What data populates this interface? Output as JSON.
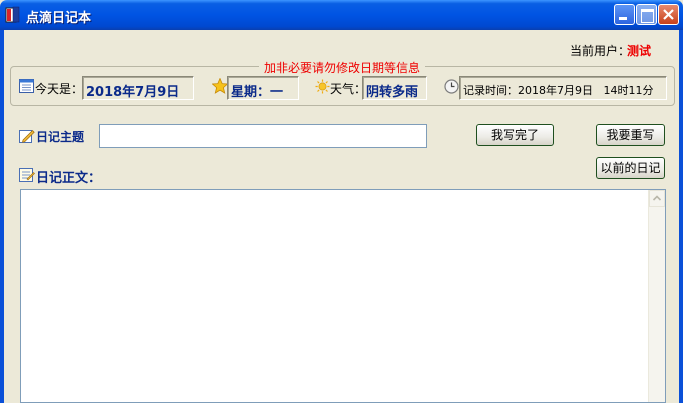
{
  "window": {
    "title": "点滴日记本"
  },
  "user": {
    "label": "当前用户：",
    "name": "测试"
  },
  "info_group": {
    "caption": "加非必要请勿修改日期等信息",
    "today_label": "今天是：",
    "today_value": "2018年7月9日",
    "weekday_label": "星期：",
    "weekday_value": "一",
    "weather_label": "天气：",
    "weather_value": "阴转多雨",
    "record_time_label": "记录时间：",
    "record_time_value": "2018年7月9日   14时11分"
  },
  "subject": {
    "label": "日记主题",
    "value": ""
  },
  "buttons": {
    "done": "我写完了",
    "rewrite": "我要重写",
    "history": "以前的日记"
  },
  "body": {
    "label": "日记正文：",
    "value": ""
  },
  "colors": {
    "titlebar": "#0054e3",
    "window_bg": "#ece9d8",
    "caption_red": "#ee0000",
    "value_blue": "#0b2a8a"
  },
  "icons": [
    "app-icon",
    "calendar-icon",
    "star-icon",
    "sun-icon",
    "clock-icon",
    "pencil-icon",
    "notepad-icon"
  ]
}
